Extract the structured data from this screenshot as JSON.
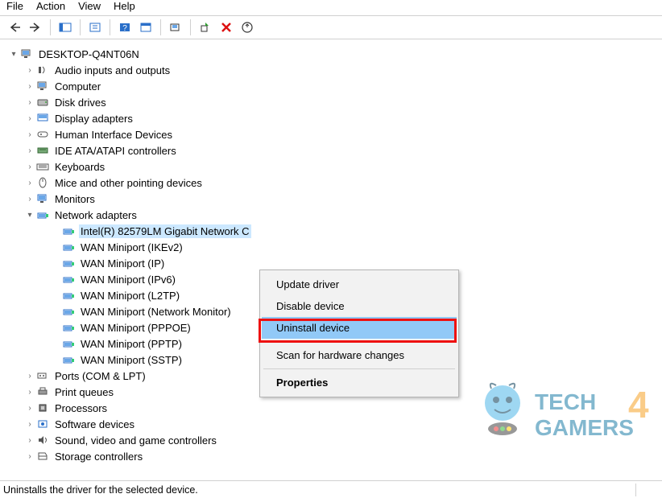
{
  "menubar": {
    "file": "File",
    "action": "Action",
    "view": "View",
    "help": "Help"
  },
  "root": {
    "name": "DESKTOP-Q4NT06N"
  },
  "categories": [
    {
      "label": "Audio inputs and outputs",
      "icon": "audio",
      "expanded": false
    },
    {
      "label": "Computer",
      "icon": "computer",
      "expanded": false
    },
    {
      "label": "Disk drives",
      "icon": "disk",
      "expanded": false
    },
    {
      "label": "Display adapters",
      "icon": "display",
      "expanded": false
    },
    {
      "label": "Human Interface Devices",
      "icon": "hid",
      "expanded": false
    },
    {
      "label": "IDE ATA/ATAPI controllers",
      "icon": "ide",
      "expanded": false
    },
    {
      "label": "Keyboards",
      "icon": "keyboard",
      "expanded": false
    },
    {
      "label": "Mice and other pointing devices",
      "icon": "mouse",
      "expanded": false
    },
    {
      "label": "Monitors",
      "icon": "monitor",
      "expanded": false
    },
    {
      "label": "Network adapters",
      "icon": "network",
      "expanded": true,
      "children": [
        {
          "label": "Intel(R) 82579LM Gigabit Network C",
          "selected": true
        },
        {
          "label": "WAN Miniport (IKEv2)"
        },
        {
          "label": "WAN Miniport (IP)"
        },
        {
          "label": "WAN Miniport (IPv6)"
        },
        {
          "label": "WAN Miniport (L2TP)"
        },
        {
          "label": "WAN Miniport (Network Monitor)"
        },
        {
          "label": "WAN Miniport (PPPOE)"
        },
        {
          "label": "WAN Miniport (PPTP)"
        },
        {
          "label": "WAN Miniport (SSTP)"
        }
      ]
    },
    {
      "label": "Ports (COM & LPT)",
      "icon": "ports",
      "expanded": false
    },
    {
      "label": "Print queues",
      "icon": "printer",
      "expanded": false
    },
    {
      "label": "Processors",
      "icon": "processor",
      "expanded": false
    },
    {
      "label": "Software devices",
      "icon": "software",
      "expanded": false
    },
    {
      "label": "Sound, video and game controllers",
      "icon": "sound",
      "expanded": false
    },
    {
      "label": "Storage controllers",
      "icon": "storage",
      "expanded": false
    }
  ],
  "contextmenu": {
    "update": "Update driver",
    "disable": "Disable device",
    "uninstall": "Uninstall device",
    "scan": "Scan for hardware changes",
    "properties": "Properties"
  },
  "statusbar": {
    "text": "Uninstalls the driver for the selected device."
  },
  "watermark": {
    "line1": "TECH",
    "line2": "GAMERS",
    "digit": "4"
  }
}
